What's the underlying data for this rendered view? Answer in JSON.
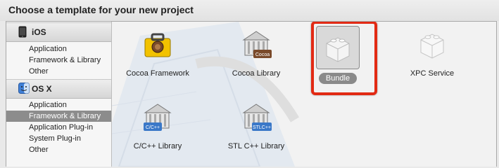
{
  "header": {
    "title": "Choose a template for your new project"
  },
  "sidebar": {
    "ios": {
      "label": "iOS",
      "items": [
        "Application",
        "Framework & Library",
        "Other"
      ]
    },
    "osx": {
      "label": "OS X",
      "items": [
        "Application",
        "Framework & Library",
        "Application Plug-in",
        "System Plug-in",
        "Other"
      ],
      "selected_index": 1
    }
  },
  "templates": [
    {
      "label": "Cocoa Framework",
      "icon": "toolbox-icon"
    },
    {
      "label": "Cocoa Library",
      "icon": "library-building-icon",
      "badge": "Cocoa"
    },
    {
      "label": "Bundle",
      "icon": "bundle-lego-icon",
      "selected": true
    },
    {
      "label": "XPC Service",
      "icon": "lego-brick-icon"
    },
    {
      "label": "C/C++ Library",
      "icon": "library-building-icon",
      "badge": "C/C++"
    },
    {
      "label": "STL C++ Library",
      "icon": "library-building-icon",
      "badge": "STLC++"
    }
  ],
  "colors": {
    "highlight": "#e22a14",
    "selection": "#8c8c8c"
  }
}
